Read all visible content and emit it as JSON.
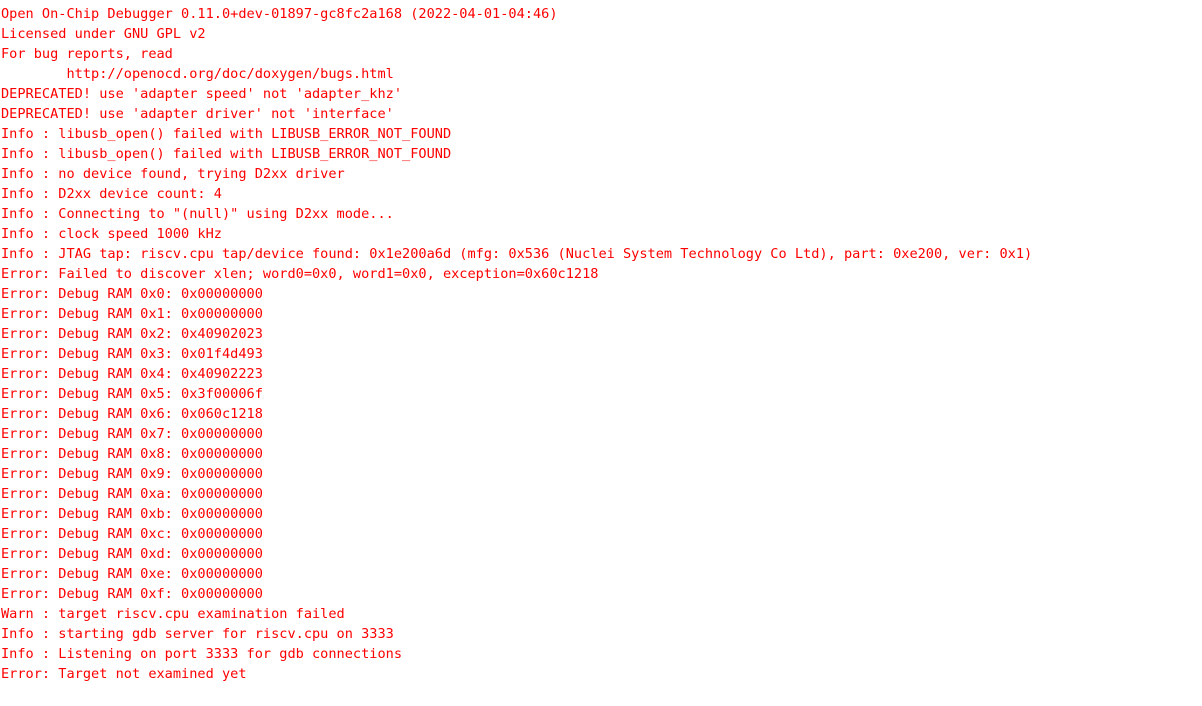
{
  "terminal": {
    "app_name": "Open On-Chip Debugger",
    "background_color": "#ffffff",
    "text_color": "#fe0000",
    "lines": [
      "Open On-Chip Debugger 0.11.0+dev-01897-gc8fc2a168 (2022-04-01-04:46)",
      "Licensed under GNU GPL v2",
      "For bug reports, read",
      "        http://openocd.org/doc/doxygen/bugs.html",
      "DEPRECATED! use 'adapter speed' not 'adapter_khz'",
      "DEPRECATED! use 'adapter driver' not 'interface'",
      "Info : libusb_open() failed with LIBUSB_ERROR_NOT_FOUND",
      "Info : libusb_open() failed with LIBUSB_ERROR_NOT_FOUND",
      "Info : no device found, trying D2xx driver",
      "Info : D2xx device count: 4",
      "Info : Connecting to \"(null)\" using D2xx mode...",
      "Info : clock speed 1000 kHz",
      "Info : JTAG tap: riscv.cpu tap/device found: 0x1e200a6d (mfg: 0x536 (Nuclei System Technology Co Ltd), part: 0xe200, ver: 0x1)",
      "Error: Failed to discover xlen; word0=0x0, word1=0x0, exception=0x60c1218",
      "Error: Debug RAM 0x0: 0x00000000",
      "Error: Debug RAM 0x1: 0x00000000",
      "Error: Debug RAM 0x2: 0x40902023",
      "Error: Debug RAM 0x3: 0x01f4d493",
      "Error: Debug RAM 0x4: 0x40902223",
      "Error: Debug RAM 0x5: 0x3f00006f",
      "Error: Debug RAM 0x6: 0x060c1218",
      "Error: Debug RAM 0x7: 0x00000000",
      "Error: Debug RAM 0x8: 0x00000000",
      "Error: Debug RAM 0x9: 0x00000000",
      "Error: Debug RAM 0xa: 0x00000000",
      "Error: Debug RAM 0xb: 0x00000000",
      "Error: Debug RAM 0xc: 0x00000000",
      "Error: Debug RAM 0xd: 0x00000000",
      "Error: Debug RAM 0xe: 0x00000000",
      "Error: Debug RAM 0xf: 0x00000000",
      "Warn : target riscv.cpu examination failed",
      "Info : starting gdb server for riscv.cpu on 3333",
      "Info : Listening on port 3333 for gdb connections",
      "Error: Target not examined yet"
    ]
  }
}
